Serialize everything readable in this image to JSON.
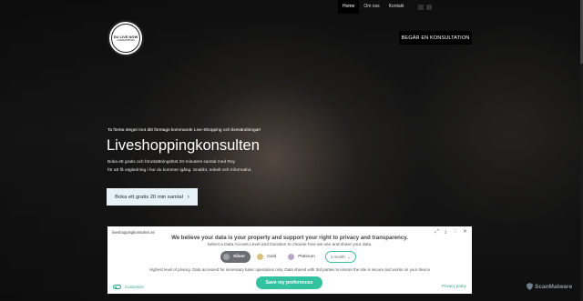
{
  "nav": {
    "items": [
      {
        "label": "Home",
        "active": true
      },
      {
        "label": "Om oss",
        "active": false
      },
      {
        "label": "Kontakt",
        "active": false
      }
    ],
    "extra_icons": [
      "square-icon",
      "square-icon"
    ]
  },
  "logo": {
    "text": "DU LIVE NOW",
    "sub": "LIVESHOPPING"
  },
  "consult_button": "BEGÄR EN KONSULTATION",
  "hero": {
    "kicker": "Ta första steget mot ditt företags kommande Live-Shopping och livesändningar!",
    "title": "Liveshoppingkonsulten",
    "lead1": "Boka ett gratis och förutsättningslöst 20-minuters samtal med Roy",
    "lead2": "för att få vägledning i hur du kommer igång. Snabbt, enkelt och informativt.",
    "cta_label": "Boka ett gratis 20 min samtal"
  },
  "cookie_banner": {
    "site": "liveshoppingkonsulten.se",
    "heading": "We believe your data is your property and support your right to privacy and transparency.",
    "subheading": "Select a Data Access Level and Duration to choose how we use and share your data.",
    "levels": [
      {
        "label": "Silver",
        "selected": true,
        "color": "#9ea3a8"
      },
      {
        "label": "Gold",
        "selected": false,
        "color": "#d8c07a"
      },
      {
        "label": "Platinum",
        "selected": false,
        "color": "#b8a8c8"
      }
    ],
    "duration": "1 month",
    "description": "Highest level of privacy. Data accessed for necessary basic operations only. Data shared with 3rd parties to ensure the site is secure and works on your device",
    "customize_label": "Customize",
    "save_label": "Save my preferences",
    "privacy_label": "Privacy policy"
  },
  "watermark": "ScanMalware",
  "colors": {
    "accent": "#33c3a0",
    "cta_bg": "#e6f1f8",
    "dark": "#000000"
  }
}
